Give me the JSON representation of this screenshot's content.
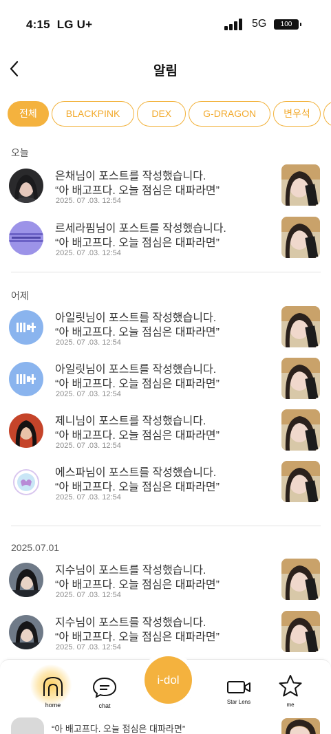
{
  "status": {
    "time": "4:15",
    "carrier": "LG U+",
    "network": "5G",
    "battery": "100"
  },
  "header": {
    "title": "알림",
    "back_icon": "chevron-left-icon"
  },
  "filters": [
    {
      "label": "전체",
      "active": true
    },
    {
      "label": "BLACKPINK",
      "active": false
    },
    {
      "label": "DEX",
      "active": false
    },
    {
      "label": "G-DRAGON",
      "active": false
    },
    {
      "label": "변우석",
      "active": false
    }
  ],
  "sections": {
    "today": "오늘",
    "yesterday": "어제",
    "older": "2025.07.01"
  },
  "notifications": [
    {
      "title": "은채님이 포스트를 작성했습니다.",
      "quote": "“아 배고프다. 오늘 점심은 대파라면”",
      "date": "2025. 07 .03. 12:54",
      "avatar": "eunchae-avatar"
    },
    {
      "title": "르세라핌님이 포스트를 작성했습니다.",
      "quote": "“아 배고프다. 오늘 점심은 대파라면”",
      "date": "2025. 07 .03. 12:54",
      "avatar": "lesserafim-avatar"
    },
    {
      "title": "아일릿님이 포스트를 작성했습니다.",
      "quote": "“아 배고프다. 오늘 점심은 대파라면”",
      "date": "2025. 07 .03. 12:54",
      "avatar": "illit-avatar"
    },
    {
      "title": "아일릿님이 포스트를 작성했습니다.",
      "quote": "“아 배고프다. 오늘 점심은 대파라면”",
      "date": "2025. 07 .03. 12:54",
      "avatar": "illit-avatar"
    },
    {
      "title": "제니님이 포스트를 작성했습니다.",
      "quote": "“아 배고프다. 오늘 점심은 대파라면”",
      "date": "2025. 07 .03. 12:54",
      "avatar": "jennie-avatar"
    },
    {
      "title": "에스파님이 포스트를 작성했습니다.",
      "quote": "“아 배고프다. 오늘 점심은 대파라면”",
      "date": "2025. 07 .03. 12:54",
      "avatar": "aespa-avatar"
    },
    {
      "title": "지수님이 포스트를 작성했습니다.",
      "quote": "“아 배고프다. 오늘 점심은 대파라면”",
      "date": "2025. 07 .03. 12:54",
      "avatar": "jisoo-avatar"
    },
    {
      "title": "지수님이 포스트를 작성했습니다.",
      "quote": "“아 배고프다. 오늘 점심은 대파라면”",
      "date": "2025. 07 .03. 12:54",
      "avatar": "jisoo-avatar"
    }
  ],
  "partial_row": {
    "quote": "“아 배고프다. 오늘 점심은 대파라면”"
  },
  "tabbar": {
    "home": "home",
    "chat": "chat",
    "center": "i-dol",
    "starlens": "Star Lens",
    "me": "me"
  },
  "colors": {
    "accent": "#f4b23e",
    "chip_text": "#f2a92b",
    "divider": "#e2e2e2"
  }
}
